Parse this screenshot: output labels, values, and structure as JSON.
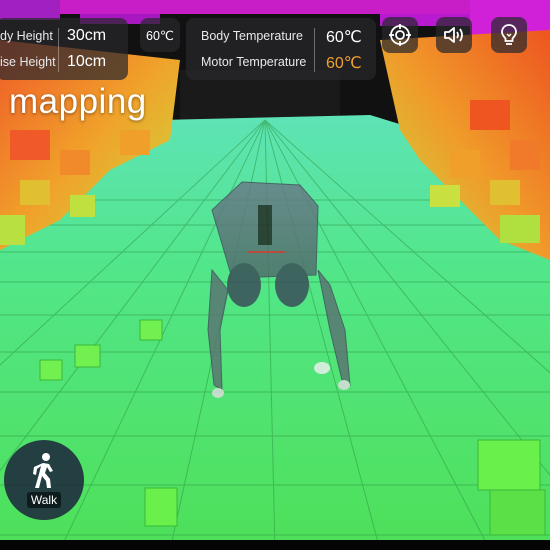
{
  "hud": {
    "height_panel": {
      "body_height_label": "dy Height",
      "body_height_value": "30cm",
      "raise_height_label": "ise Height",
      "raise_height_value": "10cm"
    },
    "small_temp": "60℃",
    "temp_panel": {
      "body_temp_label": "Body Temperature",
      "body_temp_value": "60℃",
      "motor_temp_label": "Motor Temperature",
      "motor_temp_value": "60℃"
    },
    "icons": [
      "target-icon",
      "speaker-icon",
      "lightbulb-icon"
    ]
  },
  "mode_label": "mapping",
  "walk_button": {
    "label": "Walk",
    "icon": "walking-person-icon"
  },
  "colors": {
    "floor_green": "#4de55a",
    "grid_line": "#2f9a45",
    "voxel_orange": "#f07a2a",
    "voxel_yellow": "#d8d83a",
    "voxel_magenta": "#d020d8",
    "voxel_purple": "#6020e0",
    "warning": "#f0a030"
  }
}
